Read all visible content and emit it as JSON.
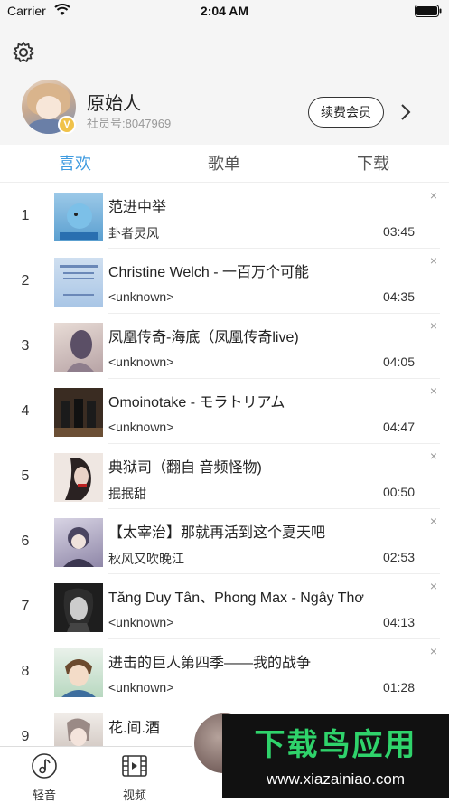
{
  "status_bar": {
    "carrier": "Carrier",
    "time": "2:04 AM"
  },
  "profile": {
    "name": "原始人",
    "member_id": "社员号:8047969",
    "badge": "V",
    "renew_label": "续费会员"
  },
  "tabs": [
    {
      "label": "喜欢",
      "active": true
    },
    {
      "label": "歌单",
      "active": false
    },
    {
      "label": "下载",
      "active": false
    }
  ],
  "songs": [
    {
      "index": "1",
      "title": "范进中举",
      "artist": "卦者灵风",
      "duration": "03:45"
    },
    {
      "index": "2",
      "title": "Christine Welch - 一百万个可能",
      "artist": "<unknown>",
      "duration": "04:35"
    },
    {
      "index": "3",
      "title": "凤凰传奇-海底（凤凰传奇live)",
      "artist": "<unknown>",
      "duration": "04:05"
    },
    {
      "index": "4",
      "title": "Omoinotake - モラトリアム",
      "artist": "<unknown>",
      "duration": "04:47"
    },
    {
      "index": "5",
      "title": "典狱司（翻自 音频怪物)",
      "artist": "抿抿甜",
      "duration": "00:50"
    },
    {
      "index": "6",
      "title": "【太宰治】那就再活到这个夏天吧",
      "artist": "秋风又吹晚江",
      "duration": "02:53"
    },
    {
      "index": "7",
      "title": "Tăng Duy Tân、Phong Max - Ngây Thơ",
      "artist": "<unknown>",
      "duration": "04:13"
    },
    {
      "index": "8",
      "title": "进击的巨人第四季——我的战争",
      "artist": "<unknown>",
      "duration": "01:28"
    },
    {
      "index": "9",
      "title": "花.间.酒",
      "artist": "",
      "duration": ""
    }
  ],
  "close_symbol": "×",
  "bottom_nav": [
    {
      "label": "轻音",
      "icon": "music-note-icon"
    },
    {
      "label": "视频",
      "icon": "film-icon"
    }
  ],
  "watermark": {
    "big": "下载鸟应用",
    "small": "www.xiazainiao.com"
  },
  "colors": {
    "accent": "#3f9be0",
    "header_bg": "#f5f5f5",
    "vip_gold": "#f0c24a"
  }
}
